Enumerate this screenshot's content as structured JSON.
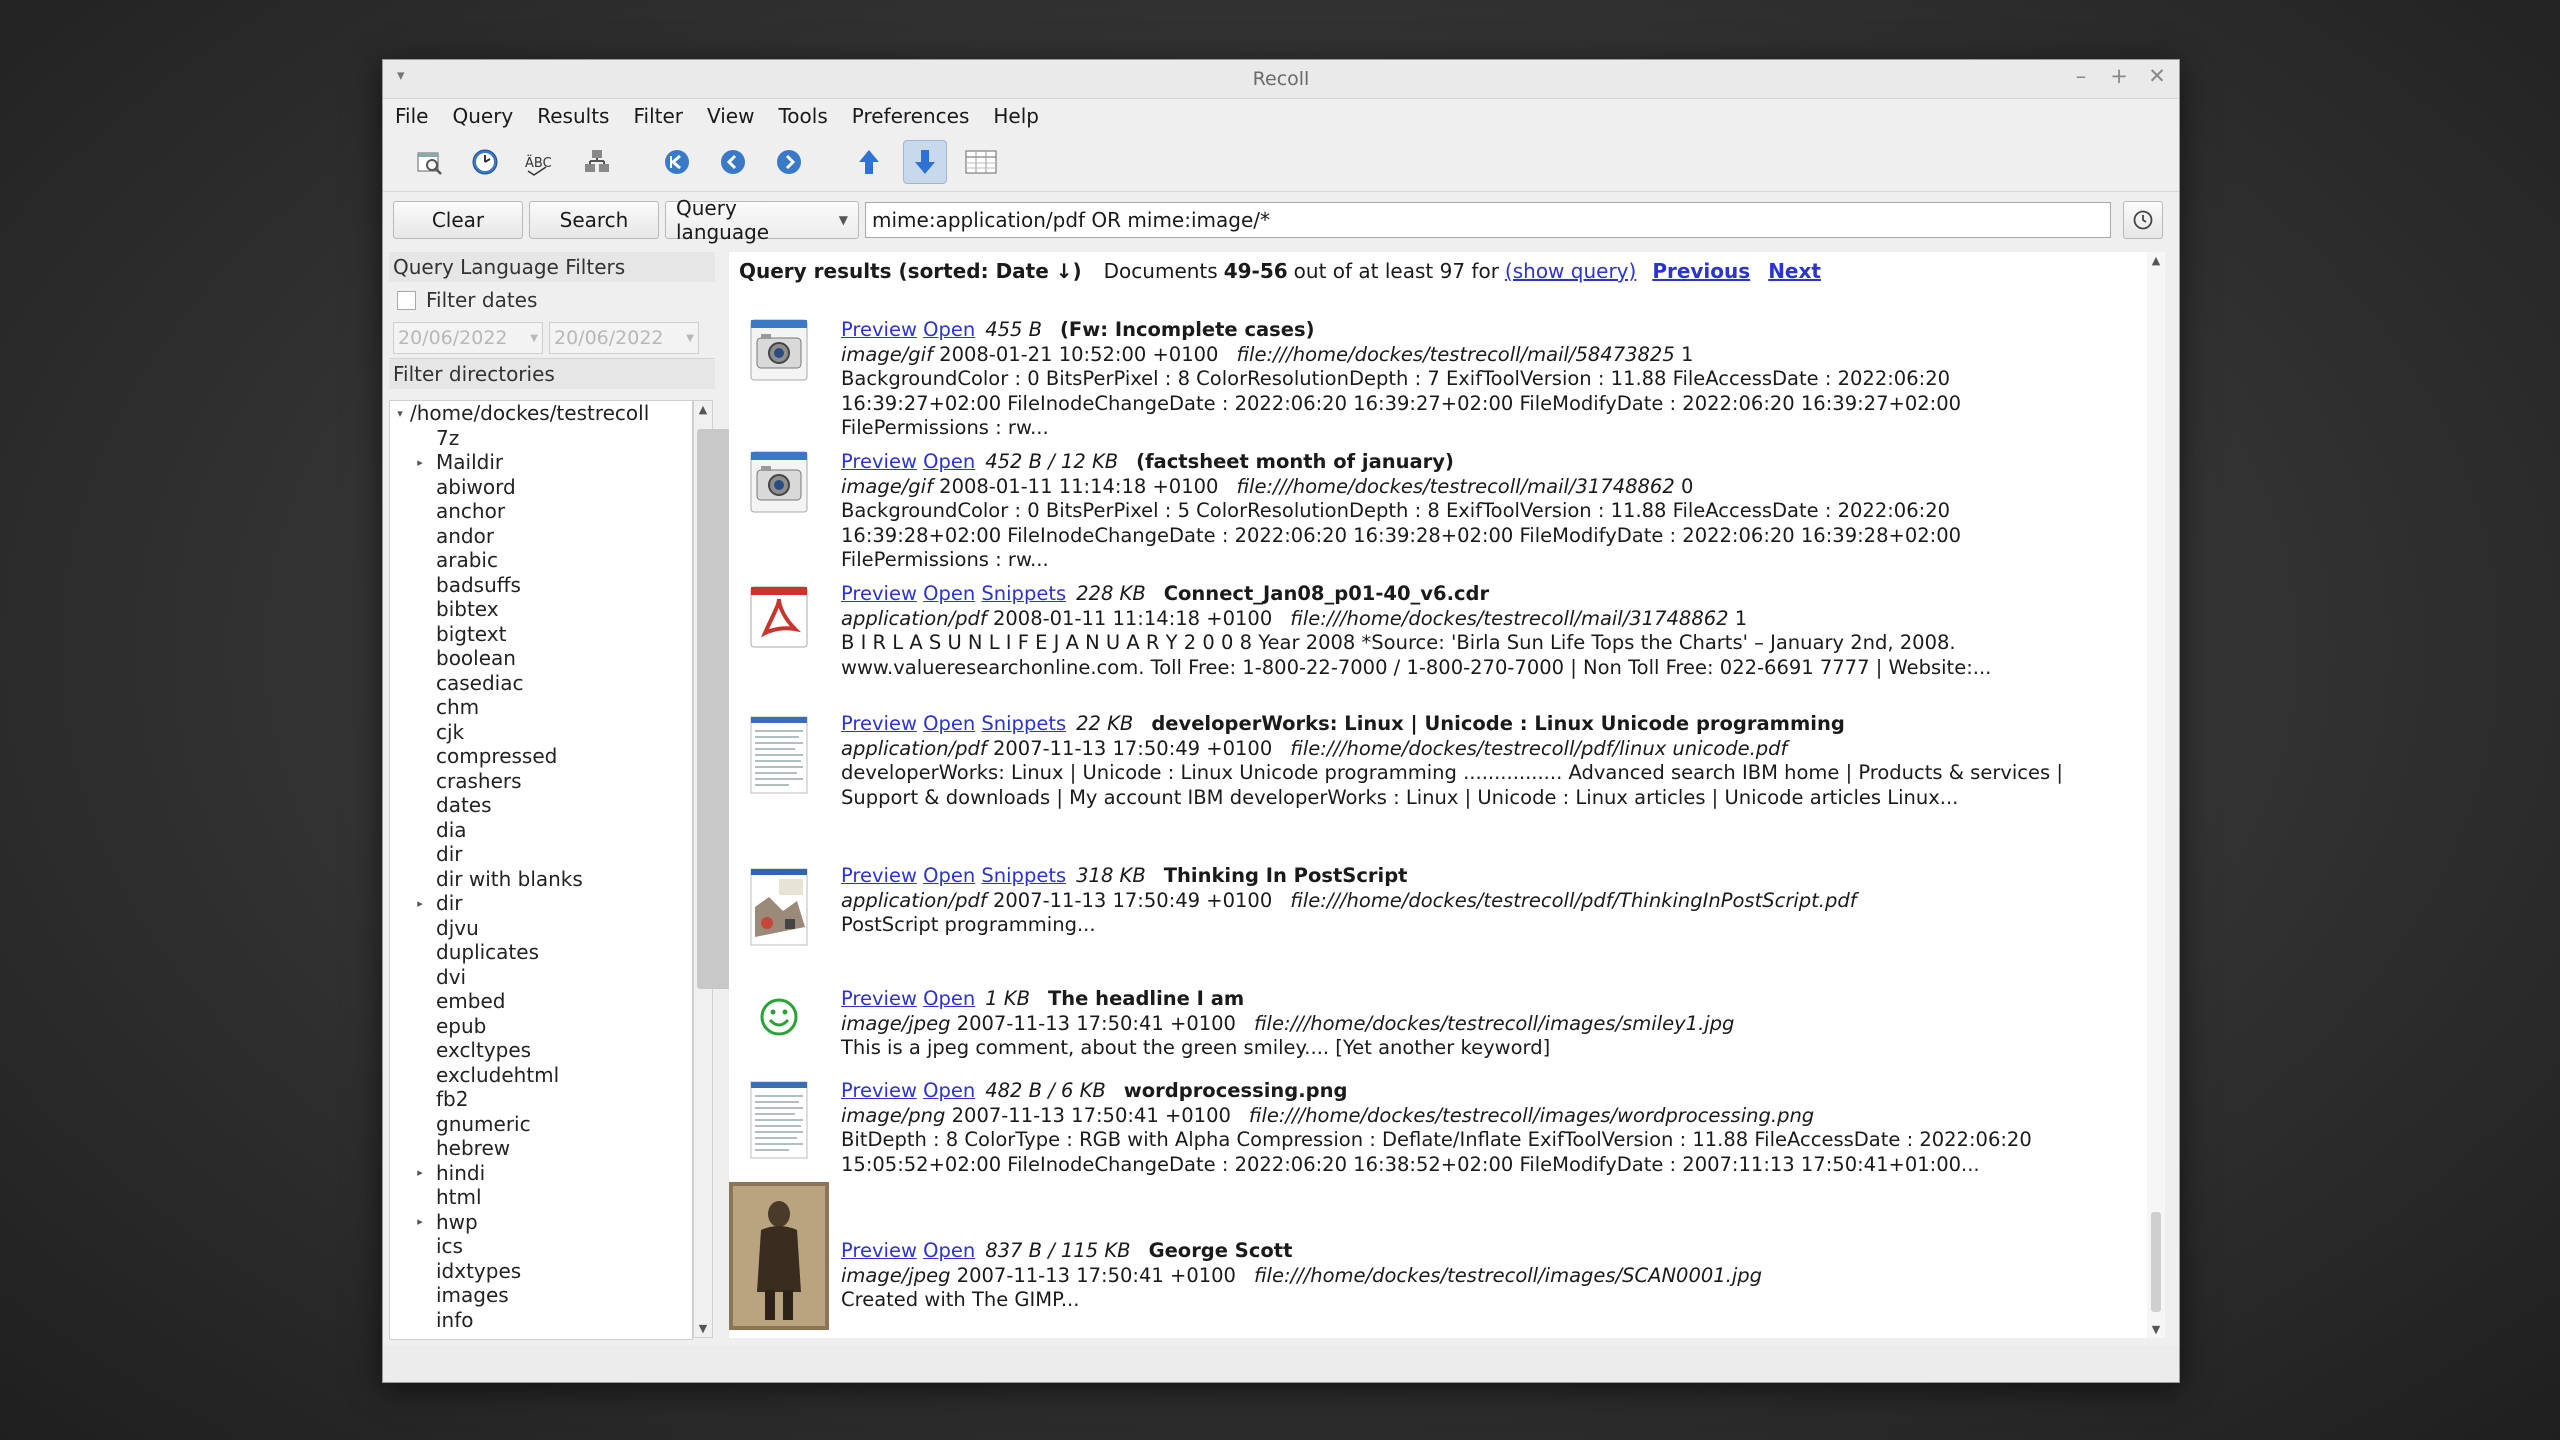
{
  "window": {
    "title": "Recoll"
  },
  "menubar": [
    "File",
    "Query",
    "Results",
    "Filter",
    "View",
    "Tools",
    "Preferences",
    "Help"
  ],
  "search": {
    "clear_label": "Clear",
    "search_label": "Search",
    "mode": "Query language",
    "query": "mime:application/pdf OR mime:image/*"
  },
  "sidebar": {
    "filters_title": "Query Language Filters",
    "filter_dates_label": "Filter dates",
    "date_from": "20/06/2022",
    "date_to": "20/06/2022",
    "dirs_title": "Filter directories",
    "root": "/home/dockes/testrecoll",
    "dirs": [
      {
        "name": "7z",
        "exp": false
      },
      {
        "name": "Maildir",
        "exp": true
      },
      {
        "name": "abiword",
        "exp": false
      },
      {
        "name": "anchor",
        "exp": false
      },
      {
        "name": "andor",
        "exp": false
      },
      {
        "name": "arabic",
        "exp": false
      },
      {
        "name": "badsuffs",
        "exp": false
      },
      {
        "name": "bibtex",
        "exp": false
      },
      {
        "name": "bigtext",
        "exp": false
      },
      {
        "name": "boolean",
        "exp": false
      },
      {
        "name": "casediac",
        "exp": false
      },
      {
        "name": "chm",
        "exp": false
      },
      {
        "name": "cjk",
        "exp": false
      },
      {
        "name": "compressed",
        "exp": false
      },
      {
        "name": "crashers",
        "exp": false
      },
      {
        "name": "dates",
        "exp": false
      },
      {
        "name": "dia",
        "exp": false
      },
      {
        "name": "dir",
        "exp": false
      },
      {
        "name": "dir with blanks",
        "exp": false
      },
      {
        "name": "dir",
        "exp": true
      },
      {
        "name": "djvu",
        "exp": false
      },
      {
        "name": "duplicates",
        "exp": false
      },
      {
        "name": "dvi",
        "exp": false
      },
      {
        "name": "embed",
        "exp": false
      },
      {
        "name": "epub",
        "exp": false
      },
      {
        "name": "excltypes",
        "exp": false
      },
      {
        "name": "excludehtml",
        "exp": false
      },
      {
        "name": "fb2",
        "exp": false
      },
      {
        "name": "gnumeric",
        "exp": false
      },
      {
        "name": "hebrew",
        "exp": false
      },
      {
        "name": "hindi",
        "exp": true
      },
      {
        "name": "html",
        "exp": false
      },
      {
        "name": "hwp",
        "exp": true
      },
      {
        "name": "ics",
        "exp": false
      },
      {
        "name": "idxtypes",
        "exp": false
      },
      {
        "name": "images",
        "exp": false
      },
      {
        "name": "info",
        "exp": false
      }
    ]
  },
  "results_header": {
    "title": "Query results (sorted: Date ↓)",
    "docs_prefix": "Documents",
    "range": "49-56",
    "docs_suffix": "out of at least 97 for",
    "show_query": "(show query)",
    "previous": "Previous",
    "next": "Next"
  },
  "common": {
    "preview": "Preview",
    "open": "Open",
    "snippets": "Snippets"
  },
  "results": [
    {
      "thumb": "camera",
      "size": "455 B",
      "title": "(Fw: Incomplete cases)",
      "snippets": false,
      "mime": "image/gif",
      "date": "2008-01-21 10:52:00 +0100",
      "url": "file:///home/dockes/testrecoll/mail/58473825",
      "page": "1",
      "abstract": [
        "BackgroundColor : 0 BitsPerPixel : 8 ColorResolutionDepth : 7 ExifToolVersion : 11.88 FileAccessDate : 2022:06:20",
        "16:39:27+02:00 FileInodeChangeDate : 2022:06:20 16:39:27+02:00 FileModifyDate : 2022:06:20 16:39:27+02:00",
        "FilePermissions : rw..."
      ]
    },
    {
      "thumb": "camera",
      "size": "452 B / 12 KB",
      "title": "(factsheet month of january)",
      "snippets": false,
      "mime": "image/gif",
      "date": "2008-01-11 11:14:18 +0100",
      "url": "file:///home/dockes/testrecoll/mail/31748862",
      "page": "0",
      "abstract": [
        "BackgroundColor : 0 BitsPerPixel : 5 ColorResolutionDepth : 8 ExifToolVersion : 11.88 FileAccessDate : 2022:06:20",
        "16:39:28+02:00 FileInodeChangeDate : 2022:06:20 16:39:28+02:00 FileModifyDate : 2022:06:20 16:39:28+02:00",
        "FilePermissions : rw..."
      ]
    },
    {
      "thumb": "pdf",
      "size": "228 KB",
      "title": "Connect_Jan08_p01-40_v6.cdr",
      "snippets": true,
      "mime": "application/pdf",
      "date": "2008-01-11 11:14:18 +0100",
      "url": "file:///home/dockes/testrecoll/mail/31748862",
      "page": "1",
      "abstract": [
        "B I R L A S U N L I F E J A N U A R Y 2 0 0 8 Year 2008 *Source: 'Birla Sun Life Tops the Charts' – January 2nd, 2008.",
        "www.valueresearchonline.com. Toll Free: 1-800-22-7000 / 1-800-270-7000 | Non Toll Free: 022-6691 7777 | Website:..."
      ]
    },
    {
      "thumb": "doc",
      "size": "22 KB",
      "title": "developerWorks: Linux | Unicode : Linux Unicode programming",
      "snippets": true,
      "mime": "application/pdf",
      "date": "2007-11-13 17:50:49 +0100",
      "url": "file:///home/dockes/testrecoll/pdf/linux unicode.pdf",
      "page": "",
      "abstract": [
        "developerWorks: Linux | Unicode : Linux Unicode programming ................ Advanced search IBM home | Products & services |",
        "Support & downloads | My account IBM developerWorks : Linux | Unicode : Linux articles | Unicode articles Linux..."
      ]
    },
    {
      "thumb": "book",
      "size": "318 KB",
      "title": "Thinking In PostScript",
      "snippets": true,
      "mime": "application/pdf",
      "date": "2007-11-13 17:50:49 +0100",
      "url": "file:///home/dockes/testrecoll/pdf/ThinkingInPostScript.pdf",
      "page": "",
      "abstract": [
        "PostScript programming..."
      ]
    },
    {
      "thumb": "smiley",
      "size": "1 KB",
      "title": "The headline I am",
      "snippets": false,
      "mime": "image/jpeg",
      "date": "2007-11-13 17:50:41 +0100",
      "url": "file:///home/dockes/testrecoll/images/smiley1.jpg",
      "page": "",
      "abstract": [
        "This is a jpeg comment, about the green smiley.... [Yet another keyword]"
      ]
    },
    {
      "thumb": "doc",
      "size": "482 B / 6 KB",
      "title": "wordprocessing.png",
      "snippets": false,
      "mime": "image/png",
      "date": "2007-11-13 17:50:41 +0100",
      "url": "file:///home/dockes/testrecoll/images/wordprocessing.png",
      "page": "",
      "abstract": [
        "BitDepth : 8 ColorType : RGB with Alpha Compression : Deflate/Inflate ExifToolVersion : 11.88 FileAccessDate : 2022:06:20",
        "15:05:52+02:00 FileInodeChangeDate : 2022:06:20 16:38:52+02:00 FileModifyDate : 2007:11:13 17:50:41+01:00..."
      ]
    },
    {
      "thumb": "photo",
      "size": "837 B / 115 KB",
      "title": "George Scott",
      "snippets": false,
      "mime": "image/jpeg",
      "date": "2007-11-13 17:50:41 +0100",
      "url": "file:///home/dockes/testrecoll/images/SCAN0001.jpg",
      "page": "",
      "abstract": [
        "Created with The GIMP..."
      ]
    }
  ]
}
